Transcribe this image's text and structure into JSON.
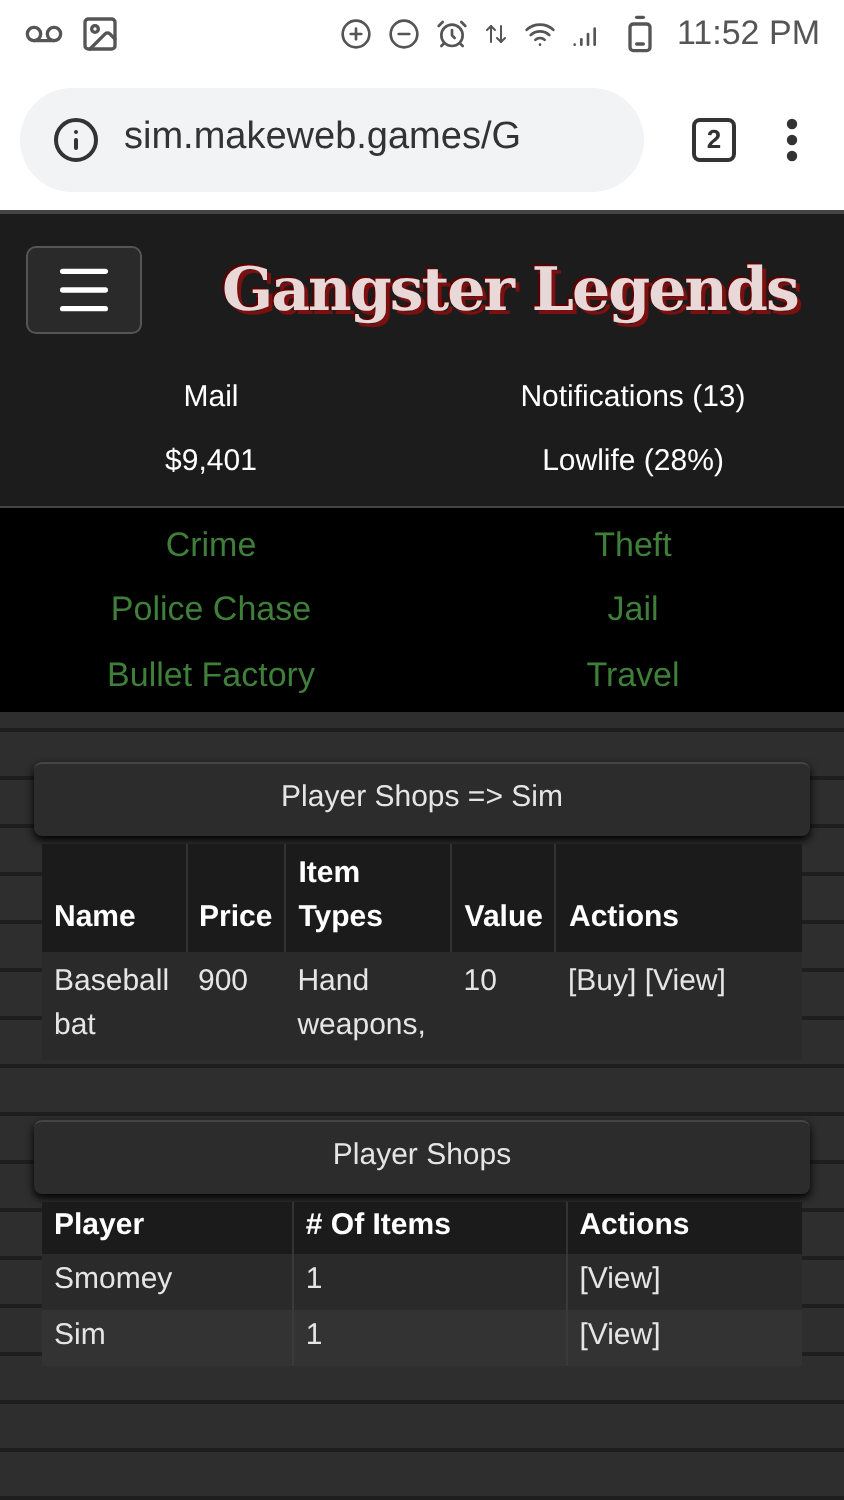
{
  "status_bar": {
    "time": "11:52 PM"
  },
  "browser": {
    "url": "sim.makeweb.games/G",
    "tab_count": "2"
  },
  "header": {
    "logo": "Gangster Legends"
  },
  "stats": [
    "Mail",
    "Notifications (13)",
    "$9,401",
    "Lowlife (28%)"
  ],
  "nav": [
    "Crime",
    "Theft",
    "Police Chase",
    "Jail",
    "Bullet Factory",
    "Travel"
  ],
  "shop_items": {
    "title": "Player Shops => Sim",
    "columns": [
      "Name",
      "Price",
      "Item Types",
      "Value",
      "Actions"
    ],
    "rows": [
      {
        "cells": [
          "Baseball bat",
          "900",
          "Hand weapons,",
          "10"
        ],
        "actions": [
          "[Buy]",
          "[View]"
        ]
      }
    ]
  },
  "player_shops": {
    "title": "Player Shops",
    "columns": [
      "Player",
      "# Of Items",
      "Actions"
    ],
    "rows": [
      {
        "cells": [
          "Smomey",
          "1"
        ],
        "actions": [
          "[View]"
        ]
      },
      {
        "cells": [
          "Sim",
          "1"
        ],
        "actions": [
          "[View]"
        ]
      }
    ]
  }
}
